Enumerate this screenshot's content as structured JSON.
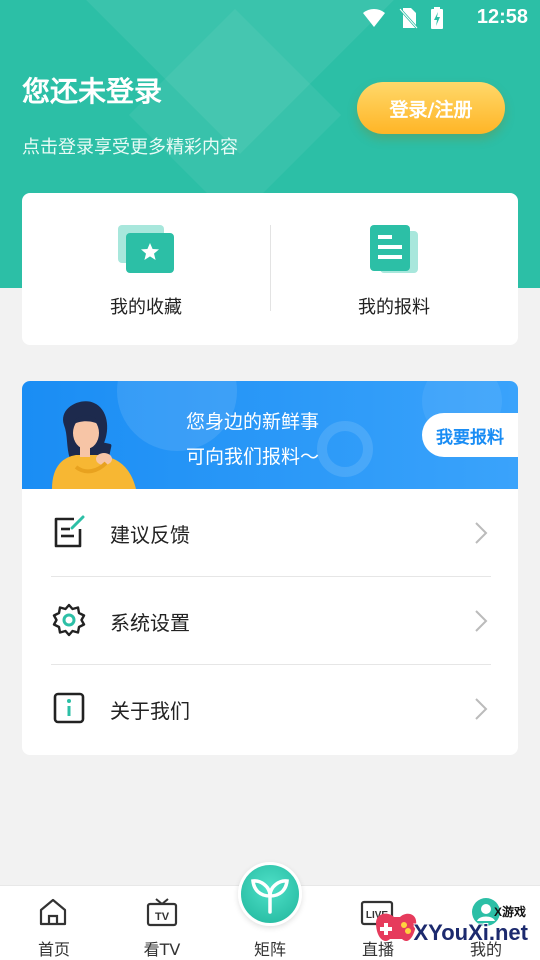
{
  "status_bar": {
    "time": "12:58"
  },
  "header": {
    "title": "您还未登录",
    "subtitle": "点击登录享受更多精彩内容",
    "login_button": "登录/注册"
  },
  "quick_actions": [
    {
      "label": "我的收藏",
      "icon": "star-folder-icon"
    },
    {
      "label": "我的报料",
      "icon": "document-icon"
    }
  ],
  "banner": {
    "line1": "您身边的新鲜事",
    "line2": "可向我们报料～",
    "button": "我要报料"
  },
  "menu": [
    {
      "label": "建议反馈",
      "icon": "edit-note-icon"
    },
    {
      "label": "系统设置",
      "icon": "gear-icon"
    },
    {
      "label": "关于我们",
      "icon": "info-icon"
    }
  ],
  "bottom_nav": [
    {
      "label": "首页",
      "icon": "home-icon"
    },
    {
      "label": "看TV",
      "icon": "tv-icon"
    },
    {
      "label": "矩阵",
      "icon": "matrix-logo-icon"
    },
    {
      "label": "直播",
      "icon": "live-icon"
    },
    {
      "label": "我的",
      "icon": "profile-icon"
    }
  ],
  "watermark": {
    "small": "X游戏",
    "large": "XYouXi.net"
  },
  "colors": {
    "primary": "#2cbfa6",
    "button_gold": "#ffb526",
    "banner_blue": "#1a8df4"
  }
}
